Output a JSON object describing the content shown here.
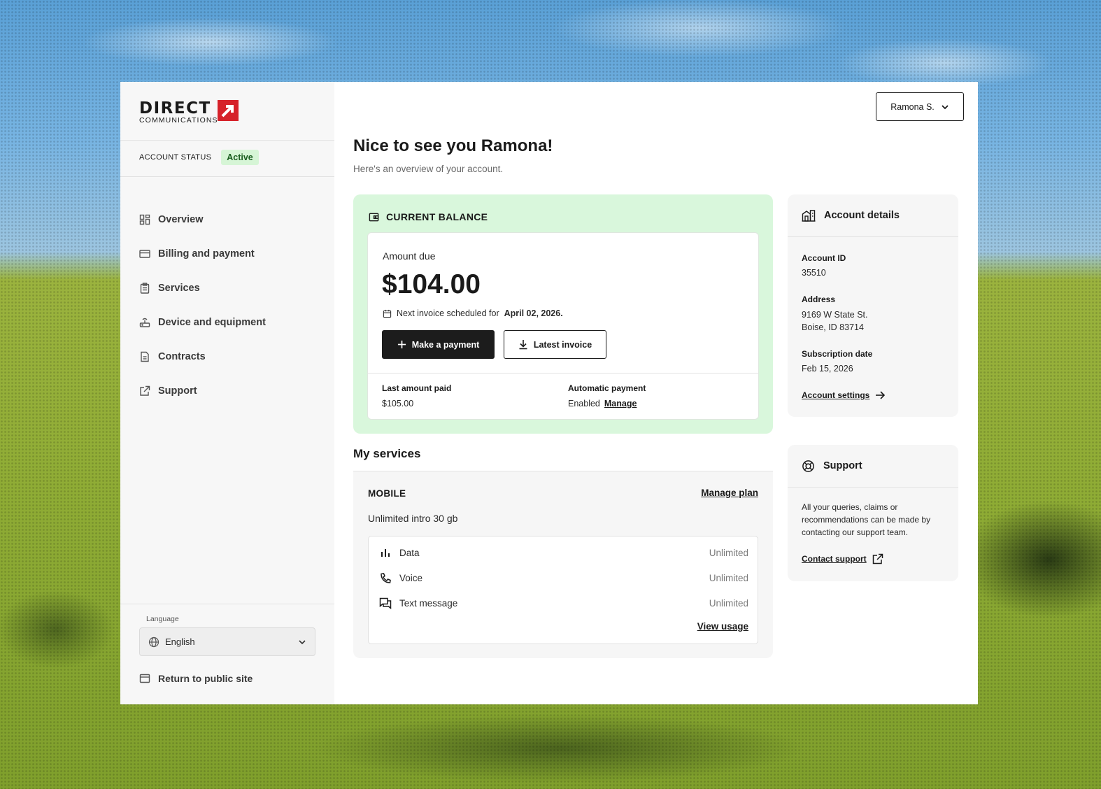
{
  "brand": {
    "name": "DIRECT",
    "subname": "COMMUNICATIONS",
    "accent": "#d6222a"
  },
  "account_status": {
    "label": "ACCOUNT STATUS",
    "value": "Active"
  },
  "sidebar": {
    "items": [
      {
        "label": "Overview",
        "icon": "grid-icon"
      },
      {
        "label": "Billing and payment",
        "icon": "credit-card-icon"
      },
      {
        "label": "Services",
        "icon": "clipboard-icon"
      },
      {
        "label": "Device and equipment",
        "icon": "router-icon"
      },
      {
        "label": "Contracts",
        "icon": "document-icon"
      },
      {
        "label": "Support",
        "icon": "external-link-icon"
      }
    ],
    "language_label": "Language",
    "language_value": "English",
    "return_label": "Return to public site"
  },
  "header": {
    "user_name": "Ramona S."
  },
  "main": {
    "greeting": "Nice to see you Ramona!",
    "subtitle": "Here's an overview of your account."
  },
  "balance": {
    "title": "CURRENT BALANCE",
    "amount_label": "Amount due",
    "amount": "$104.00",
    "next_invoice_text": "Next invoice scheduled for",
    "next_invoice_date": "April 02, 2026.",
    "make_payment": "Make a payment",
    "latest_invoice": "Latest invoice",
    "last_paid_label": "Last amount paid",
    "last_paid_value": "$105.00",
    "auto_pay_label": "Automatic payment",
    "auto_pay_value": "Enabled",
    "auto_pay_link": "Manage"
  },
  "services": {
    "title": "My services",
    "type": "MOBILE",
    "manage_plan": "Manage plan",
    "plan_name": "Unlimited intro 30 gb",
    "usage": [
      {
        "label": "Data",
        "value": "Unlimited",
        "icon": "bar-chart-icon"
      },
      {
        "label": "Voice",
        "value": "Unlimited",
        "icon": "phone-icon"
      },
      {
        "label": "Text message",
        "value": "Unlimited",
        "icon": "chat-icon"
      }
    ],
    "view_usage": "View usage"
  },
  "account_details": {
    "title": "Account details",
    "id_label": "Account ID",
    "id_value": "35510",
    "address_label": "Address",
    "address_line1": "9169 W State St.",
    "address_line2": "Boise, ID 83714",
    "sub_label": "Subscription date",
    "sub_value": "Feb 15, 2026",
    "settings_link": "Account settings"
  },
  "support": {
    "title": "Support",
    "text": "All your queries, claims or recommendations can be made by contacting our support team.",
    "link": "Contact support"
  }
}
